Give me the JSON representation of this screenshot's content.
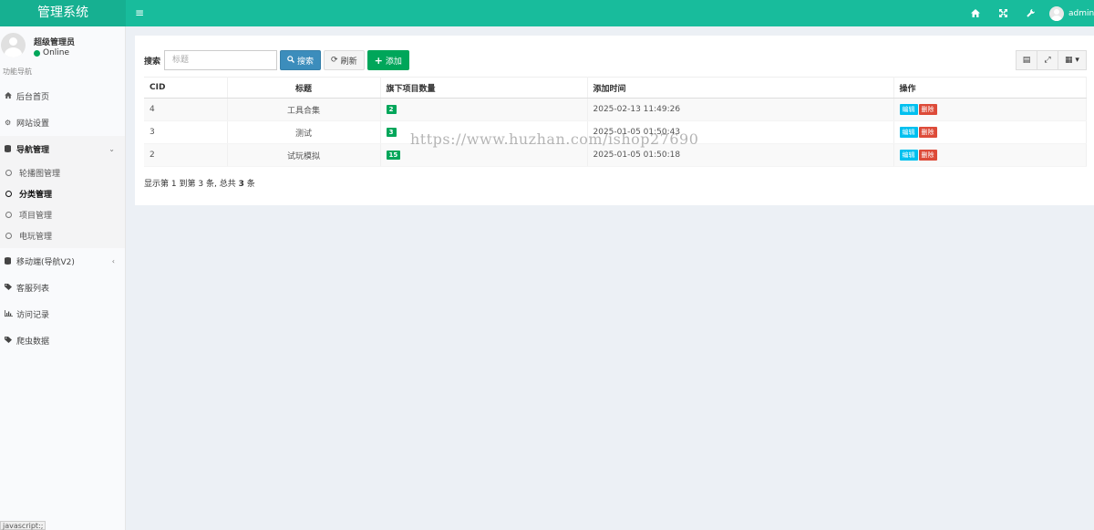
{
  "app": {
    "title": "管理系统",
    "menu_icon": "hamburger-icon"
  },
  "topbar": {
    "icons": [
      "home-icon",
      "fullscreen-icon",
      "wrench-icon"
    ],
    "user": "admin"
  },
  "sidebar": {
    "user_name": "超级管理员",
    "status": "Online",
    "nav_header": "功能导航",
    "items": [
      {
        "label": "后台首页",
        "icon": "home-icon"
      },
      {
        "label": "网站设置",
        "icon": "gears-icon"
      },
      {
        "label": "导航管理",
        "icon": "database-icon",
        "expanded": true
      },
      {
        "label": "移动端(导航V2)",
        "icon": "database-icon"
      },
      {
        "label": "客服列表",
        "icon": "tags-icon"
      },
      {
        "label": "访问记录",
        "icon": "bar-chart-icon"
      },
      {
        "label": "爬虫数据",
        "icon": "tags-icon"
      }
    ],
    "sub_items": [
      {
        "label": "轮播图管理",
        "active": false
      },
      {
        "label": "分类管理",
        "active": true
      },
      {
        "label": "项目管理",
        "active": false
      },
      {
        "label": "电玩管理",
        "active": false
      }
    ]
  },
  "toolbar": {
    "search_label": "搜索",
    "search_placeholder": "标题",
    "search_button": "搜索",
    "refresh_button": "刷新",
    "add_button": "添加"
  },
  "table": {
    "columns": [
      "CID",
      "标题",
      "旗下项目数量",
      "添加时间",
      "操作"
    ],
    "rows": [
      {
        "cid": "4",
        "title": "工具合集",
        "count": "2",
        "time": "2025-02-13 11:49:26"
      },
      {
        "cid": "3",
        "title": "测试",
        "count": "3",
        "time": "2025-01-05 01:50:43"
      },
      {
        "cid": "2",
        "title": "试玩模拟",
        "count": "15",
        "time": "2025-01-05 01:50:18"
      }
    ],
    "edit_label": "编辑",
    "delete_label": "删除"
  },
  "pager": {
    "prefix": "显示第",
    "from": "1",
    "mid1": "到第",
    "to": "3",
    "mid2": "条, 总共",
    "total": "3",
    "suffix": "条"
  },
  "watermark": "https://www.huzhan.com/ishop27690",
  "status_bar": "javascript:;"
}
